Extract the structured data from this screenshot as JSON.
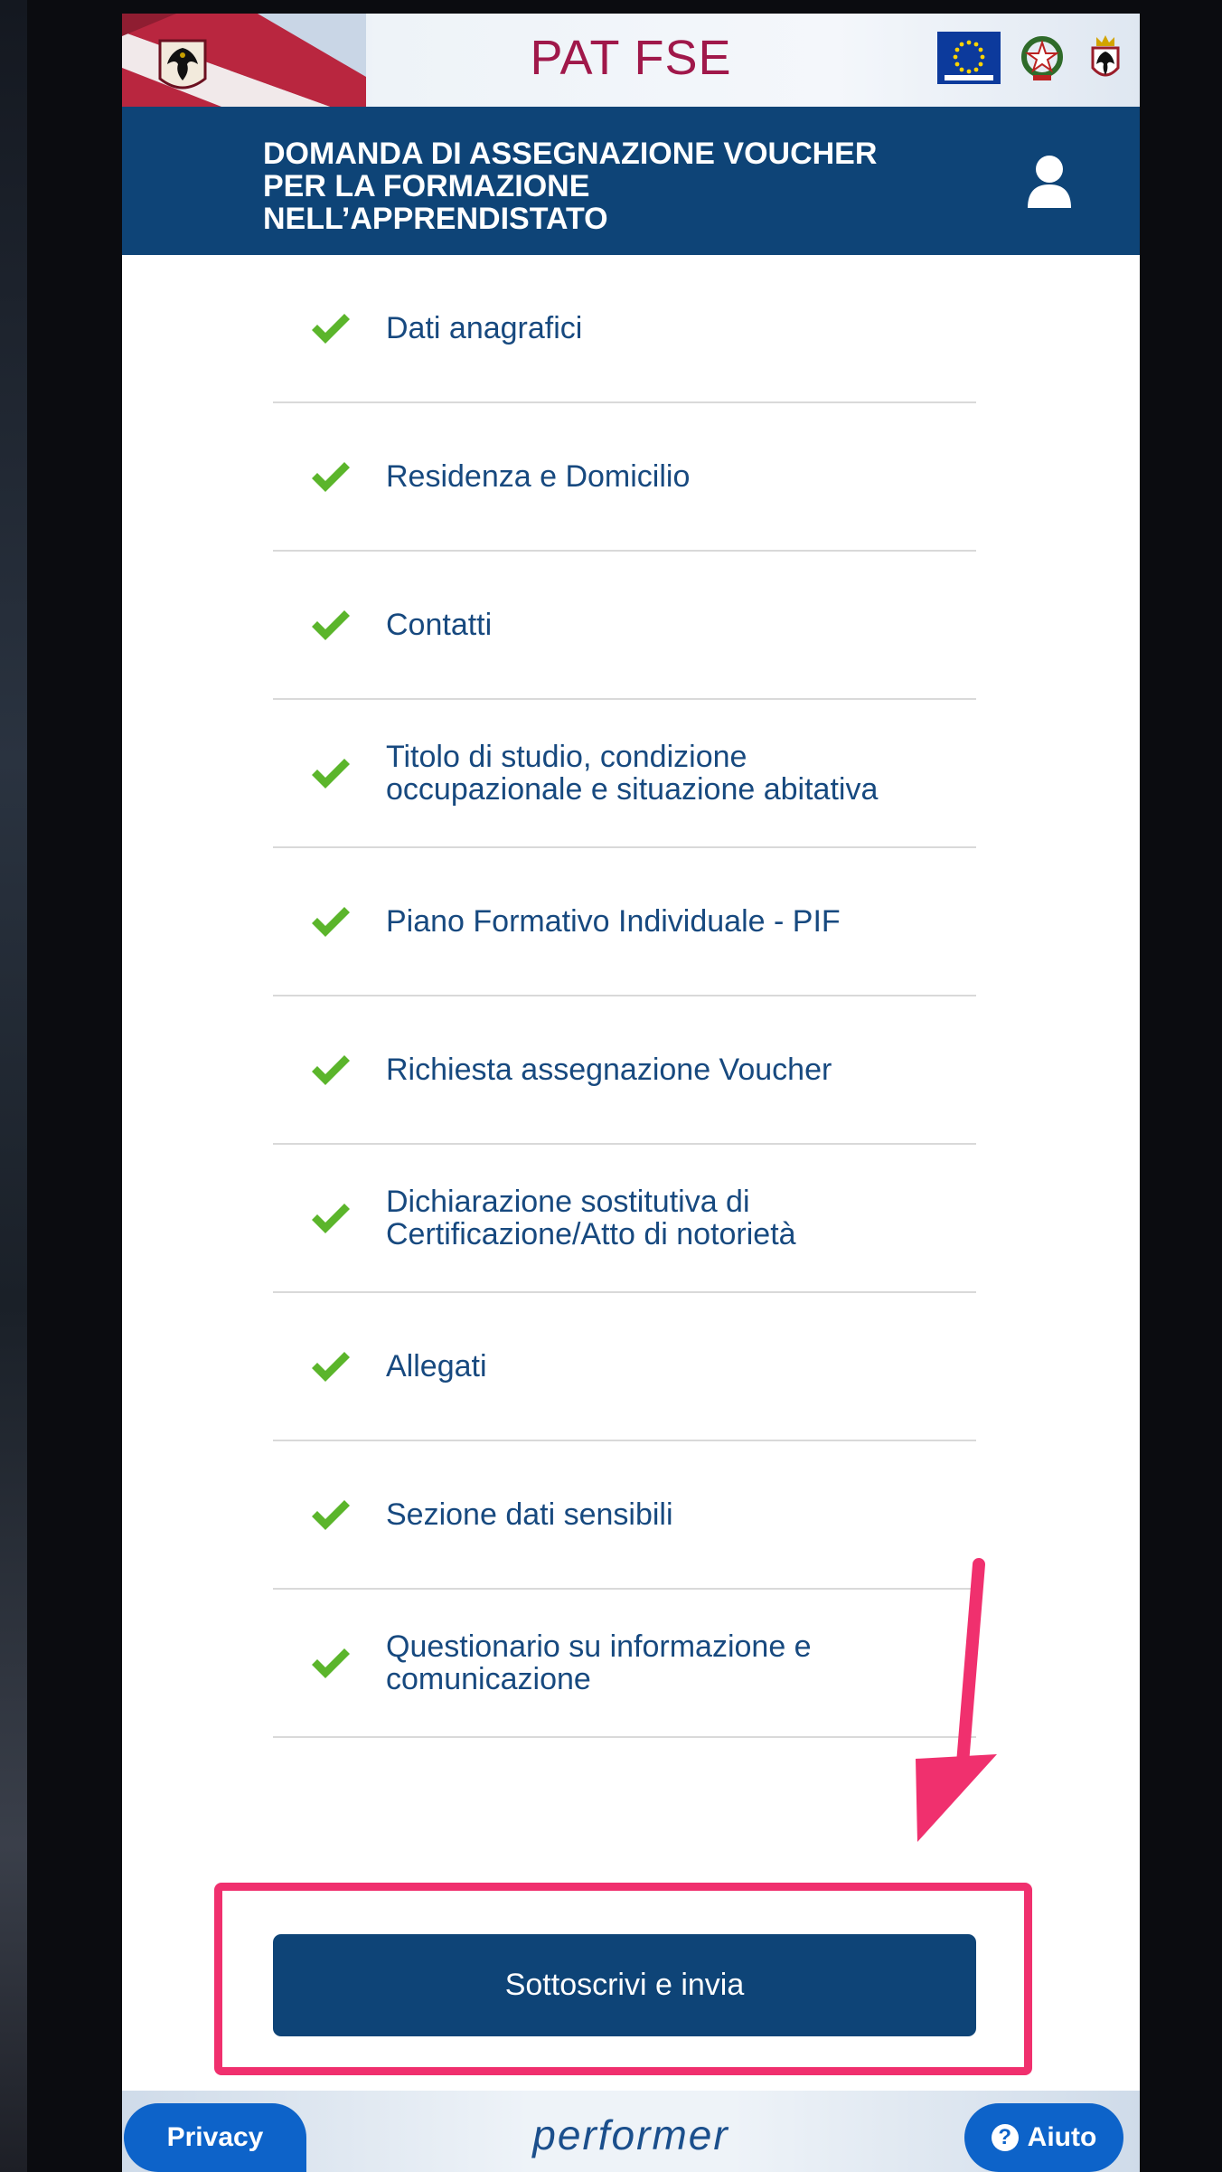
{
  "header": {
    "app_title": "PAT FSE",
    "form_title": "DOMANDA DI ASSEGNAZIONE VOUCHER\nPER LA FORMAZIONE\nNELL’APPRENDISTATO"
  },
  "steps": [
    {
      "label": "Dati anagrafici",
      "status": "completed"
    },
    {
      "label": "Residenza e Domicilio",
      "status": "completed"
    },
    {
      "label": "Contatti",
      "status": "completed"
    },
    {
      "label": "Titolo di studio, condizione\noccupazionale e situazione abitativa",
      "status": "completed"
    },
    {
      "label": "Piano Formativo Individuale - PIF",
      "status": "completed"
    },
    {
      "label": "Richiesta assegnazione Voucher",
      "status": "completed"
    },
    {
      "label": "Dichiarazione sostitutiva di\nCertificazione/Atto di notorietà",
      "status": "completed"
    },
    {
      "label": "Allegati",
      "status": "completed"
    },
    {
      "label": "Sezione dati sensibili",
      "status": "completed"
    },
    {
      "label": "Questionario su informazione e\ncomunicazione",
      "status": "completed"
    }
  ],
  "submit": {
    "label": "Sottoscrivi e invia"
  },
  "footer": {
    "privacy_label": "Privacy",
    "brand": "performer",
    "help_label": "Aiuto"
  },
  "colors": {
    "primary": "#0e4477",
    "check": "#5bb52b",
    "highlight": "#f0306e",
    "footer_button": "#0d63c9",
    "app_title": "#a0184a"
  },
  "icons": [
    "check-icon",
    "user-icon",
    "help-icon",
    "eu-flag-icon",
    "italy-emblem-icon",
    "trentino-crest-icon",
    "eagle-crest-icon"
  ]
}
